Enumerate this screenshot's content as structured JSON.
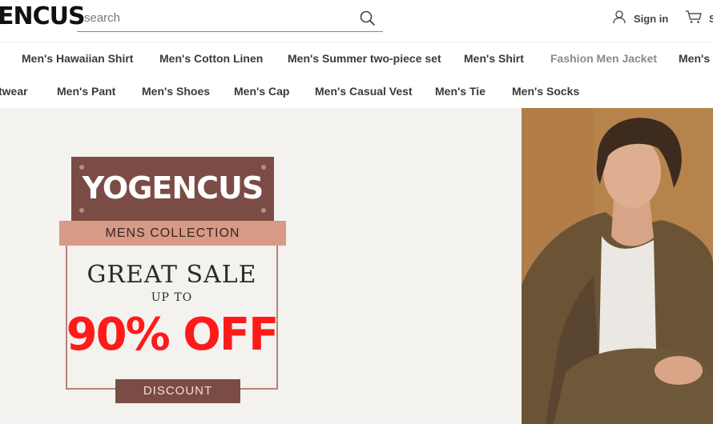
{
  "header": {
    "logo": "ENCUS",
    "search": {
      "placeholder": "search",
      "value": ""
    },
    "sign_in": "Sign in",
    "cart": "S",
    "icons": {
      "search": "search-icon",
      "user": "user-icon",
      "cart": "cart-icon"
    }
  },
  "nav": {
    "row1": [
      "Men's Hawaiian Shirt",
      "Men's Cotton Linen",
      "Men's Summer two-piece set",
      "Men's Shirt",
      "Fashion Men Jacket",
      "Men's"
    ],
    "row2": [
      "twear",
      "Men's Pant",
      "Men's Shoes",
      "Men's Cap",
      "Men's Casual Vest",
      "Men's Tie",
      "Men's Socks"
    ]
  },
  "hero": {
    "brand": "YOGENCUS",
    "collection": "MENS COLLECTION",
    "headline": "GREAT SALE",
    "up_to": "UP TO",
    "offer": "90% OFF",
    "discount_button": "DISCOUNT"
  },
  "colors": {
    "brand_brown": "#7a4c45",
    "collection_pink": "#d79a86",
    "offer_red": "#ff1a1a",
    "hero_bg": "#f3f2ef",
    "photo_bg": "#b5804a"
  }
}
